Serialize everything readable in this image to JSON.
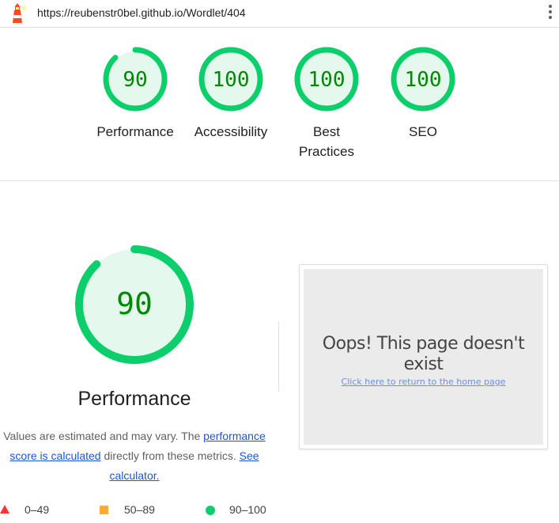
{
  "header": {
    "url": "https://reubenstr0bel.github.io/Wordlet/404",
    "logo_icon": "lighthouse-icon",
    "menu_icon": "kebab-menu-icon"
  },
  "scores": [
    {
      "value": "90",
      "label": "Performance",
      "score": 0.9
    },
    {
      "value": "100",
      "label": "Accessibility",
      "score": 1.0
    },
    {
      "value": "100",
      "label": "Best Practices",
      "score": 1.0
    },
    {
      "value": "100",
      "label": "SEO",
      "score": 1.0
    }
  ],
  "performance": {
    "value": "90",
    "score": 0.9,
    "title": "Performance",
    "desc_part1": "Values are estimated and may vary. The ",
    "desc_link1": "performance score is calculated",
    "desc_part2": " directly from these metrics. ",
    "desc_link2": "See calculator."
  },
  "screenshot": {
    "heading": "Oops! This page doesn't exist",
    "link": "Click here to return to the home page"
  },
  "legend": {
    "fail": "0–49",
    "average": "50–89",
    "pass": "90–100"
  },
  "colors": {
    "pass": "#0cce6b",
    "pass_text": "#008800",
    "pass_fill": "#e5f8ee",
    "average": "#ffaa33",
    "fail": "#ff3333"
  }
}
